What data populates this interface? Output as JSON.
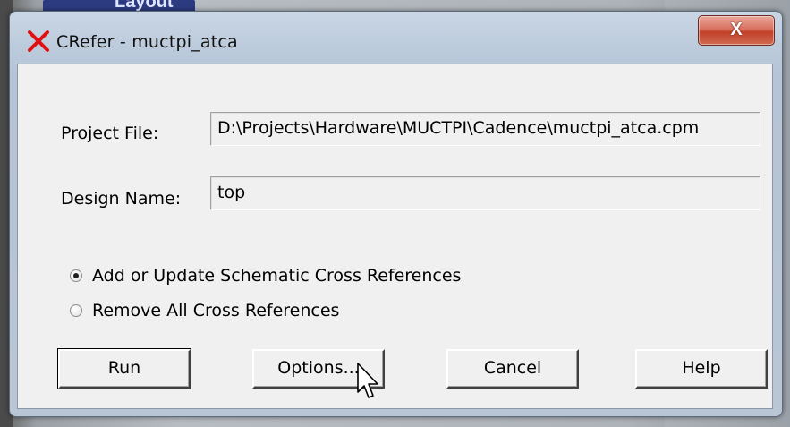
{
  "background": {
    "window_title_fragment": "Layout"
  },
  "dialog": {
    "title": "CRefer - muctpi_atca",
    "title_icon": "red-x-icon",
    "close_label": "X"
  },
  "form": {
    "project_file_label": "Project File:",
    "project_file_value": "D:\\Projects\\Hardware\\MUCTPI\\Cadence\\muctpi_atca.cpm",
    "design_name_label": "Design Name:",
    "design_name_value": "top"
  },
  "options": {
    "add_update_label": "Add or Update Schematic Cross References",
    "add_update_selected": true,
    "remove_all_label": "Remove All Cross References",
    "remove_all_selected": false
  },
  "buttons": {
    "run": "Run",
    "options": "Options...",
    "cancel": "Cancel",
    "help": "Help"
  },
  "colors": {
    "close_button": "#c2402a",
    "icon_red": "#e01010",
    "client_bg": "#f0f0f0"
  }
}
